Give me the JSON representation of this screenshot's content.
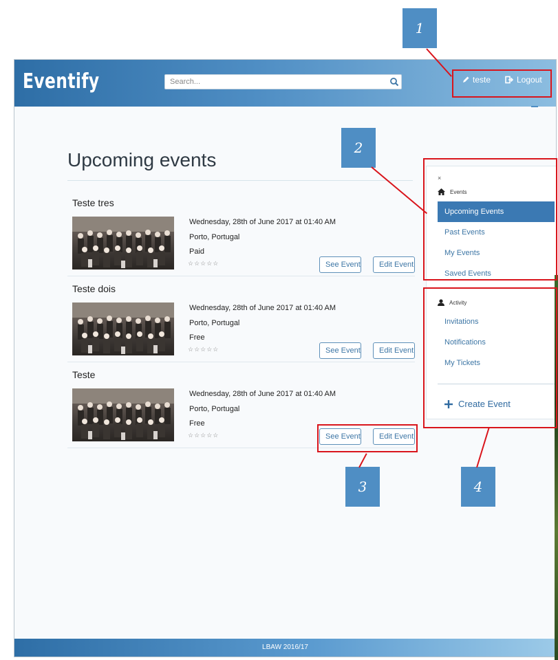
{
  "navbar": {
    "brand": "Eventify",
    "search_placeholder": "Search...",
    "user_label": "teste",
    "logout_label": "Logout"
  },
  "page_title": "Upcoming events",
  "events": [
    {
      "name": "Teste tres",
      "date": "Wednesday, 28th of June 2017 at 01:40 AM",
      "location": "Porto, Portugal",
      "price": "Paid",
      "rating_stars": "☆☆☆☆☆",
      "see_label": "See Event",
      "edit_label": "Edit Event"
    },
    {
      "name": "Teste dois",
      "date": "Wednesday, 28th of June 2017 at 01:40 AM",
      "location": "Porto, Portugal",
      "price": "Free",
      "rating_stars": "☆☆☆☆☆",
      "see_label": "See Event",
      "edit_label": "Edit Event"
    },
    {
      "name": "Teste",
      "date": "Wednesday, 28th of June 2017 at 01:40 AM",
      "location": "Porto, Portugal",
      "price": "Free",
      "rating_stars": "☆☆☆☆☆",
      "see_label": "See Event",
      "edit_label": "Edit Event"
    }
  ],
  "sidebar": {
    "close_label": "×",
    "events_section": "Events",
    "events_items": [
      "Upcoming Events",
      "Past Events",
      "My Events",
      "Saved Events"
    ],
    "activity_section": "Activity",
    "activity_items": [
      "Invitations",
      "Notifications",
      "My Tickets"
    ],
    "create_label": "Create Event"
  },
  "footer": "LBAW 2016/17",
  "annotations": [
    "1",
    "2",
    "3",
    "4"
  ],
  "colors": {
    "accent": "#4f8ec4",
    "annotation": "#d9141b",
    "active_item": "#3b79b3"
  },
  "icons": [
    "pencil-icon",
    "logout-icon",
    "search-icon",
    "home-icon",
    "user-icon",
    "plus-icon"
  ]
}
